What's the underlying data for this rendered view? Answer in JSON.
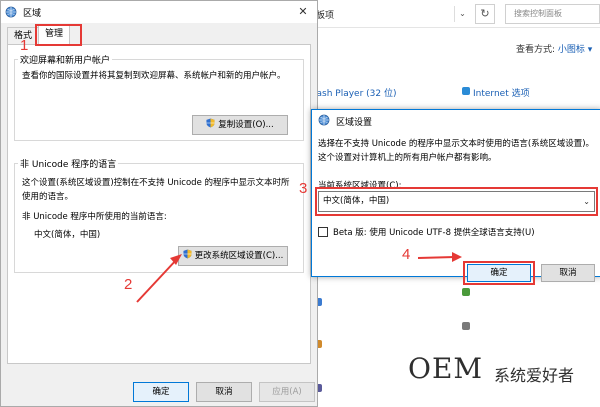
{
  "control_panel": {
    "address_text": "板项",
    "search_placeholder": "搜索控制面板",
    "view_label": "查看方式:",
    "view_value": "小图标 ▾",
    "items": [
      {
        "label": "lash Player (32 位)"
      },
      {
        "label": "Internet 选项"
      }
    ]
  },
  "region_dialog": {
    "title": "区域",
    "tabs": [
      {
        "label": "格式"
      },
      {
        "label": "管理"
      }
    ],
    "welcome_group": {
      "title": "欢迎屏幕和新用户帐户",
      "description": "查看你的国际设置并将其复制到欢迎屏幕、系统帐户和新的用户帐户。",
      "button": "复制设置(O)..."
    },
    "nonunicode_group": {
      "title": "非 Unicode 程序的语言",
      "description": "这个设置(系统区域设置)控制在不支持 Unicode 的程序中显示文本时所使用的语言。",
      "current_label": "非 Unicode 程序中所使用的当前语言:",
      "current_value": "中文(简体，中国)",
      "button": "更改系统区域设置(C)..."
    },
    "buttons": {
      "ok": "确定",
      "cancel": "取消",
      "apply": "应用(A)"
    }
  },
  "region_settings_dialog": {
    "title": "区域设置",
    "description": "选择在不支持 Unicode 的程序中显示文本时使用的语言(系统区域设置)。这个设置对计算机上的所有用户帐户都有影响。",
    "locale_label": "当前系统区域设置(C):",
    "locale_value": "中文(简体，中国)",
    "beta_label": "Beta 版: 使用 Unicode UTF-8 提供全球语言支持(U)",
    "beta_checked": false,
    "ok": "确定",
    "cancel": "取消"
  },
  "annotations": {
    "step1": "1",
    "step2": "2",
    "step3": "3",
    "step4": "4",
    "color": "#e53935"
  },
  "watermark": {
    "oem": "OEM",
    "text": "系统爱好者"
  }
}
